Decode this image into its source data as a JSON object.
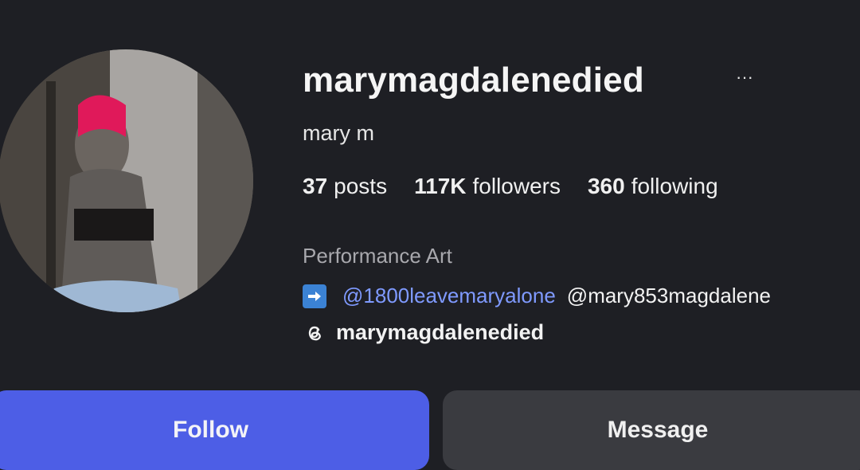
{
  "profile": {
    "username": "marymagdalenedied",
    "more_label": "···",
    "display_name": "mary m",
    "stats": {
      "posts": {
        "count": "37",
        "label": "posts"
      },
      "followers": {
        "count": "117K",
        "label": "followers"
      },
      "following": {
        "count": "360",
        "label": "following"
      }
    },
    "category": "Performance Art",
    "links": {
      "arrow_icon": "right-arrow-emoji",
      "primary_mention": "@1800leavemaryalone",
      "secondary_mention": "@mary853magdalene"
    },
    "threads": {
      "icon": "threads-icon",
      "handle": "marymagdalenedied"
    }
  },
  "actions": {
    "follow_label": "Follow",
    "message_label": "Message"
  },
  "colors": {
    "background": "#1e1f24",
    "follow_button": "#4d5ee6",
    "message_button": "#3a3b40",
    "link_blue": "#7f9aff"
  }
}
